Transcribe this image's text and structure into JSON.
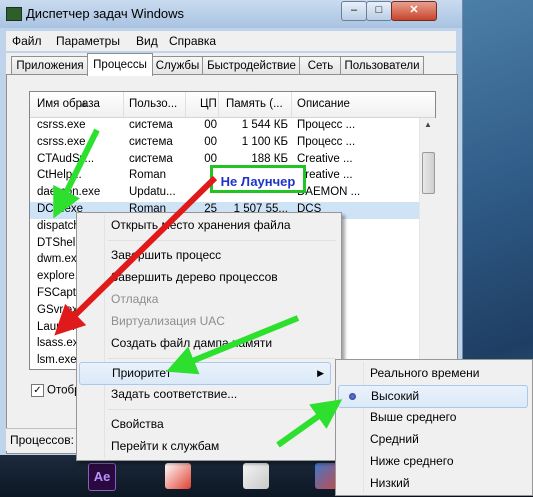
{
  "window": {
    "title": "Диспетчер задач Windows",
    "controls": {
      "minimize": "–",
      "maximize": "□",
      "close": "✕"
    }
  },
  "menubar": [
    "Файл",
    "Параметры",
    "Вид",
    "Справка"
  ],
  "tabs": [
    "Приложения",
    "Процессы",
    "Службы",
    "Быстродействие",
    "Сеть",
    "Пользователи"
  ],
  "active_tab": "Процессы",
  "table": {
    "columns": [
      "Имя образа",
      "Пользо...",
      "ЦП",
      "Память (...",
      "Описание"
    ],
    "rows": [
      [
        "csrss.exe",
        "система",
        "00",
        "1 544 КБ",
        "Процесс ..."
      ],
      [
        "csrss.exe",
        "система",
        "00",
        "1 100 КБ",
        "Процесс ..."
      ],
      [
        "CTAudSv...",
        "система",
        "00",
        "188 КБ",
        "Creative ..."
      ],
      [
        "CtHelp...",
        "Roman",
        "",
        "",
        "Creative ..."
      ],
      [
        "daemon.exe",
        "Updatu...",
        "",
        "",
        "DAEMON ..."
      ],
      [
        "DCS.exe",
        "Roman",
        "25",
        "1 507 55...",
        "DCS"
      ],
      [
        "dispatch...",
        "",
        "",
        "",
        ""
      ],
      [
        "DTShell...",
        "",
        "",
        "",
        ""
      ],
      [
        "dwm.exe",
        "",
        "",
        "",
        ""
      ],
      [
        "explore...",
        "",
        "",
        "",
        ""
      ],
      [
        "FSCapt...",
        "",
        "",
        "",
        ""
      ],
      [
        "GSvr.exe",
        "",
        "",
        "",
        ""
      ],
      [
        "Launche...",
        "",
        "",
        "",
        ""
      ],
      [
        "lsass.exe",
        "",
        "",
        "",
        ""
      ],
      [
        "lsm.exe",
        "",
        "",
        "",
        ""
      ]
    ],
    "selected_row": 5
  },
  "show_all_label": "Отобр",
  "status_label": "Процессов:",
  "context_menu": {
    "items": [
      "Открыть место хранения файла",
      "Завершить процесс",
      "Завершить дерево процессов",
      "Отладка",
      "Виртуализация UAC",
      "Создать файл дампа памяти",
      "Приоритет",
      "Задать соответствие...",
      "Свойства",
      "Перейти к службам"
    ],
    "disabled": [
      "Отладка",
      "Виртуализация UAC"
    ],
    "highlighted": "Приоритет"
  },
  "priority_submenu": {
    "items": [
      "Реального времени",
      "Высокий",
      "Выше среднего",
      "Средний",
      "Ниже среднего",
      "Низкий"
    ],
    "selected": "Высокий"
  },
  "callout": "Не Лаунчер",
  "taskbar": {
    "ae_label": "Ae"
  },
  "colors": {
    "arrow_green": "#2ee02e",
    "arrow_red": "#e01a1a",
    "callout_border": "#24c324",
    "callout_text": "#1e33c8"
  }
}
